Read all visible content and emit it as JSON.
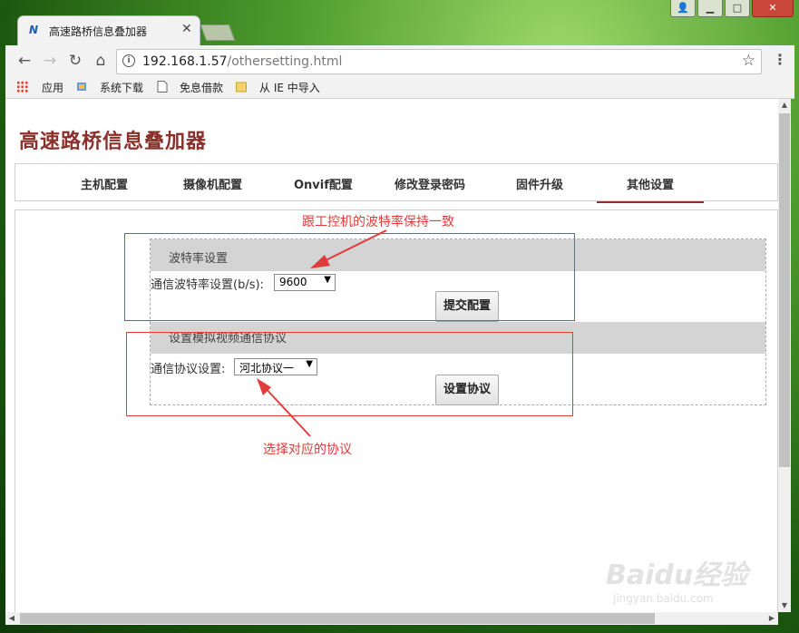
{
  "browser": {
    "tab_title": "高速路桥信息叠加器",
    "tab_favicon": "N",
    "url_host": "192.168.1.57",
    "url_path": "/othersetting.html",
    "bookmarks": [
      "应用",
      "系统下载",
      "免息借款",
      "从 IE 中导入"
    ]
  },
  "page": {
    "title": "高速路桥信息叠加器",
    "nav": [
      "主机配置",
      "摄像机配置",
      "Onvif配置",
      "修改登录密码",
      "固件升级",
      "其他设置"
    ],
    "active_nav": "其他设置"
  },
  "baud_section": {
    "heading": "波特率设置",
    "label": "通信波特率设置(b/s):",
    "value": "9600",
    "button": "提交配置"
  },
  "protocol_section": {
    "heading": "设置模拟视频通信协议",
    "label": "通信协议设置:",
    "value": "河北协议一",
    "button": "设置协议"
  },
  "annotations": {
    "top_note": "跟工控机的波特率保持一致",
    "bottom_note": "选择对应的协议",
    "color": "#e23b3b"
  },
  "watermark": {
    "main": "Baidu经验",
    "sub": "jingyan.baidu.com"
  }
}
